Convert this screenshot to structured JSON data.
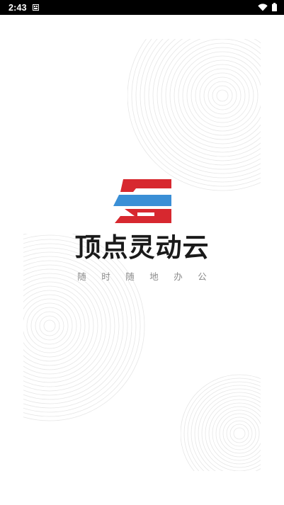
{
  "status_bar": {
    "time": "2:43",
    "notification_icon": "sim-card-icon",
    "wifi_icon": "wifi-icon",
    "battery_icon": "battery-icon"
  },
  "splash": {
    "logo_icon": "ding-dian-logo-icon",
    "app_name": "顶点灵动云",
    "slogan_chars": [
      "随",
      "时",
      "随",
      "地",
      "办",
      "公"
    ]
  },
  "colors": {
    "logo_red": "#d7282f",
    "logo_blue": "#3a8fd6",
    "title_text": "#1a1a1a",
    "slogan_text": "#8a8a8a",
    "ring_stroke": "#e6e6e6"
  }
}
